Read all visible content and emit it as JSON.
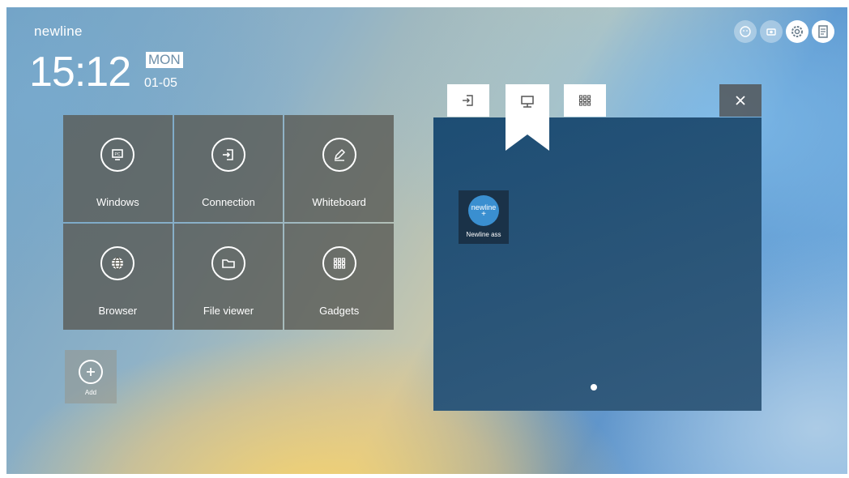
{
  "brand": "newline",
  "clock": {
    "time": "15:12",
    "day": "MON",
    "date": "01-05"
  },
  "system_icons": [
    "face-icon",
    "camera-icon",
    "settings-icon",
    "note-icon"
  ],
  "tiles": [
    {
      "label": "Windows",
      "icon": "pc-icon"
    },
    {
      "label": "Connection",
      "icon": "input-icon"
    },
    {
      "label": "Whiteboard",
      "icon": "pen-icon"
    },
    {
      "label": "Browser",
      "icon": "globe-icon"
    },
    {
      "label": "File viewer",
      "icon": "folder-icon"
    },
    {
      "label": "Gadgets",
      "icon": "grid-icon"
    }
  ],
  "add_tile": {
    "label": "Add"
  },
  "panel": {
    "tabs": [
      "input-source-tab",
      "desktop-tab",
      "apps-tab"
    ],
    "active_tab": "desktop-tab",
    "apps": [
      {
        "label": "Newline ass",
        "logo_text": "newline"
      }
    ],
    "page": {
      "current": 1,
      "total": 1
    }
  },
  "colors": {
    "tile_bg": "#58584f",
    "panel_bg": "#22507a",
    "accent": "#3a8fd0"
  }
}
